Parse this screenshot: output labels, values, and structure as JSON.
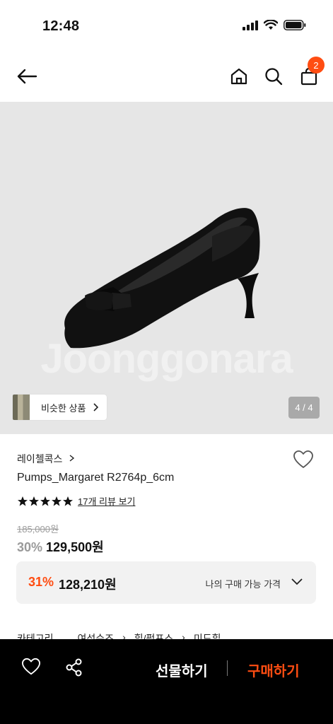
{
  "status_bar": {
    "time": "12:48"
  },
  "header": {
    "cart_count": "2"
  },
  "gallery": {
    "watermark": "Joonggonara",
    "similar_label": "비슷한 상품",
    "counter": "4 / 4"
  },
  "product": {
    "brand": "레이첼콕스",
    "name": "Pumps_Margaret R2764p_6cm",
    "rating_stars": 5,
    "review_link": "17개 리뷰 보기",
    "original_price": "185,000원",
    "discount_rate": "30%",
    "sale_price": "129,500원"
  },
  "my_price": {
    "rate": "31%",
    "price": "128,210원",
    "label": "나의 구매 가능 가격"
  },
  "category": {
    "label": "카테고리",
    "path": [
      "여성슈즈",
      "힐/펌프스",
      "미드힐"
    ]
  },
  "bottom_bar": {
    "gift_label": "선물하기",
    "buy_label": "구매하기"
  },
  "colors": {
    "accent": "#ff4d12",
    "bar": "#000000",
    "image_bg": "#e6e6e6"
  }
}
